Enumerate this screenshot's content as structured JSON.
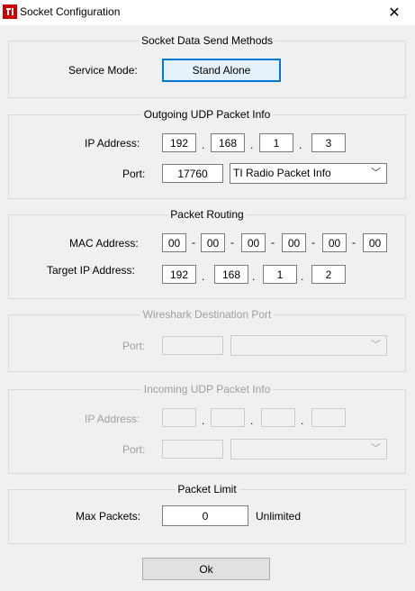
{
  "window": {
    "title": "Socket Configuration",
    "close_glyph": "✕",
    "icon": "ti-logo-icon"
  },
  "send_methods": {
    "title": "Socket Data Send Methods",
    "service_mode_label": "Service Mode:",
    "service_mode_button": "Stand Alone"
  },
  "outgoing": {
    "title": "Outgoing UDP Packet Info",
    "ip_label": "IP Address:",
    "ip": [
      "192",
      "168",
      "1",
      "3"
    ],
    "port_label": "Port:",
    "port": "17760",
    "port_type": "TI Radio Packet Info"
  },
  "routing": {
    "title": "Packet Routing",
    "mac_label": "MAC Address:",
    "mac": [
      "00",
      "00",
      "00",
      "00",
      "00",
      "00"
    ],
    "target_ip_label": "Target IP Address:",
    "target_ip": [
      "192",
      "168",
      "1",
      "2"
    ]
  },
  "wireshark": {
    "title": "Wireshark Destination Port",
    "port_label": "Port:",
    "port": "",
    "port_type": ""
  },
  "incoming": {
    "title": "Incoming UDP Packet Info",
    "ip_label": "IP Address:",
    "ip": [
      "",
      "",
      "",
      ""
    ],
    "port_label": "Port:",
    "port": "",
    "port_type": ""
  },
  "limit": {
    "title": "Packet Limit",
    "max_label": "Max Packets:",
    "max_value": "0",
    "unlimited_label": "Unlimited"
  },
  "ok_button": "Ok",
  "separators": {
    "dot": ".",
    "dash": "-",
    "chevron": "﹀"
  },
  "colors": {
    "accent": "#0078d7",
    "ti_red": "#cc0000",
    "disabled_text": "#a0a0a0"
  }
}
